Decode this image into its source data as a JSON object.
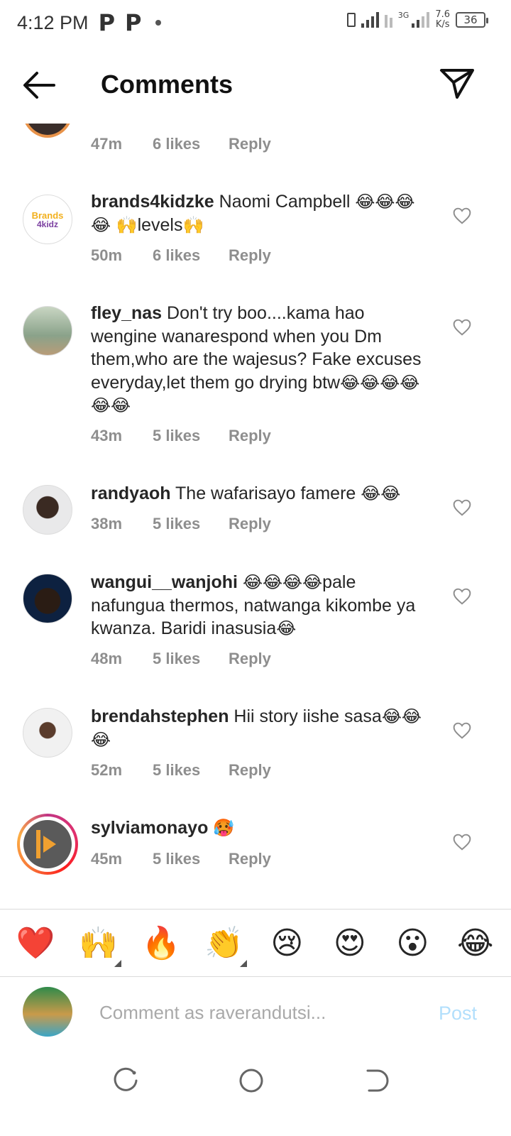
{
  "status_bar": {
    "time": "4:12 PM",
    "notif_1": "P",
    "notif_2": "P",
    "network_type": "3G",
    "speed_value": "7.6",
    "speed_unit": "K/s",
    "battery": "36"
  },
  "header": {
    "title": "Comments"
  },
  "top_partial": {
    "time": "47m",
    "likes": "6 likes",
    "reply": "Reply"
  },
  "comments": [
    {
      "username": "brands4kidzke",
      "text_1": " Naomi Campbell ",
      "emoji_1": "😂😂😂😂 🙌",
      "text_2": "levels",
      "emoji_2": "🙌",
      "time": "50m",
      "likes": "6 likes",
      "reply": "Reply",
      "avatar_line_1": "Brands",
      "avatar_line_2": "4kidz"
    },
    {
      "username": "fley_nas",
      "text_1": " Don't try boo....kama hao wengine wanarespond when you Dm them,who are the wajesus? Fake excuses everyday,let them go drying btw",
      "emoji_1": "😂😂😂😂😂😂",
      "time": "43m",
      "likes": "5 likes",
      "reply": "Reply"
    },
    {
      "username": "randyaoh",
      "text_1": " The wafarisayo famere ",
      "emoji_1": "😂😂",
      "time": "38m",
      "likes": "5 likes",
      "reply": "Reply"
    },
    {
      "username": "wangui__wanjohi",
      "text_1": " ",
      "emoji_1": "😂😂😂😂",
      "text_2": "pale nafungua thermos, natwanga kikombe ya kwanza. Baridi inasusia",
      "emoji_2": "😂",
      "time": "48m",
      "likes": "5 likes",
      "reply": "Reply"
    },
    {
      "username": "brendahstephen",
      "text_1": " Hii story iishe sasa",
      "emoji_1": "😂😂😂",
      "time": "52m",
      "likes": "5 likes",
      "reply": "Reply"
    },
    {
      "username": "sylviamonayo",
      "text_1": " ",
      "emoji_1": "🥵",
      "time": "45m",
      "likes": "5 likes",
      "reply": "Reply"
    }
  ],
  "emoji_bar": [
    "❤️",
    "🙌",
    "🔥",
    "👏",
    "😢",
    "😍",
    "😮",
    "😂"
  ],
  "input": {
    "placeholder": "Comment as raverandutsi...",
    "post_label": "Post"
  },
  "colors": {
    "post_disabled": "#b2dffc",
    "meta_gray": "#8e8e8e",
    "story_ring": "#e1306c"
  }
}
